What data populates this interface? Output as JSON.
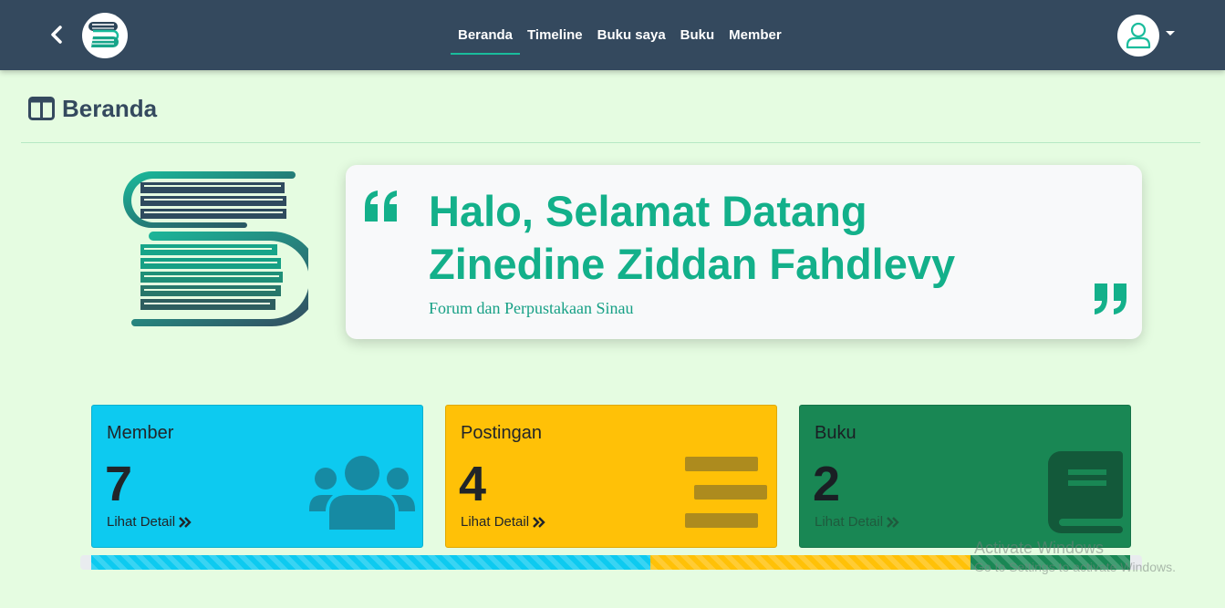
{
  "navbar": {
    "links": [
      {
        "label": "Beranda",
        "active": true
      },
      {
        "label": "Timeline",
        "active": false
      },
      {
        "label": "Buku saya",
        "active": false
      },
      {
        "label": "Buku",
        "active": false
      },
      {
        "label": "Member",
        "active": false
      }
    ],
    "icons": {
      "back": "chevron-left-icon",
      "brand": "book-stack-logo",
      "user": "user-avatar-icon",
      "dropdown": "caret-down-icon"
    }
  },
  "page": {
    "title": "Beranda",
    "title_icon": "columns-icon"
  },
  "hero": {
    "greeting_line1": "Halo, Selamat Datang",
    "greeting_line2": "Zinedine Ziddan Fahdlevy",
    "subtitle": "Forum dan Perpustakaan Sinau"
  },
  "stats": {
    "member": {
      "label": "Member",
      "value": "7",
      "link": "Lihat Detail",
      "icon": "users-icon"
    },
    "postingan": {
      "label": "Postingan",
      "value": "4",
      "link": "Lihat Detail",
      "icon": "align-center-icon"
    },
    "buku": {
      "label": "Buku",
      "value": "2",
      "link": "Lihat Detail",
      "icon": "book-icon"
    }
  },
  "progress": {
    "segments": [
      {
        "name": "member",
        "value": 7
      },
      {
        "name": "postingan",
        "value": 4
      },
      {
        "name": "buku",
        "value": 2
      }
    ]
  },
  "watermark": {
    "title": "Activate Windows",
    "subtitle": "Go to Settings to activate Windows."
  },
  "colors": {
    "navbar": "#34495e",
    "accent": "#13b08a",
    "background": "#e5fce1",
    "member": "#0dcaf0",
    "postingan": "#ffc107",
    "buku": "#198754"
  }
}
